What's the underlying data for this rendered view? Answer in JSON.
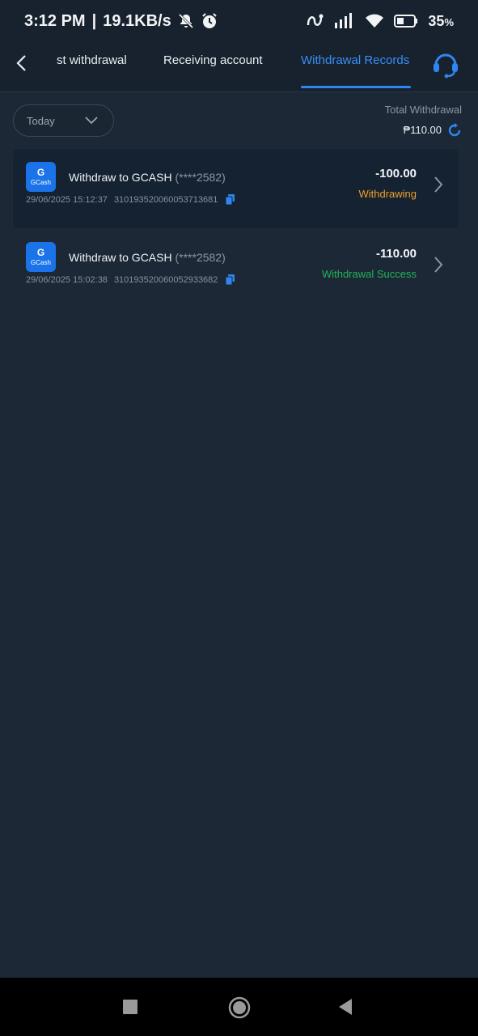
{
  "status_bar": {
    "time": "3:12 PM",
    "separator": "|",
    "speed": "19.1KB/s",
    "battery": "35",
    "battery_unit": "%"
  },
  "nav": {
    "tabs": [
      {
        "label": "st withdrawal"
      },
      {
        "label": "Receiving account"
      },
      {
        "label": "Withdrawal Records"
      }
    ],
    "active_tab": 2,
    "accent_color": "#2f86f2"
  },
  "filter": {
    "date_value": "Today",
    "total_label": "Total Withdrawal",
    "total_amount": "₱110.00"
  },
  "records": [
    {
      "logo_letter": "G",
      "logo_text": "GCash",
      "title": "Withdraw to GCASH",
      "account": "(****2582)",
      "datetime": "29/06/2025 15:12:37",
      "txn_id": "310193520060053713681",
      "amount": "-100.00",
      "status": "Withdrawing",
      "status_color": "#f0a02a"
    },
    {
      "logo_letter": "G",
      "logo_text": "GCash",
      "title": "Withdraw to GCASH",
      "account": "(****2582)",
      "datetime": "29/06/2025 15:02:38",
      "txn_id": "310193520060052933682",
      "amount": "-110.00",
      "status": "Withdrawal Success",
      "status_color": "#22b45a"
    }
  ]
}
